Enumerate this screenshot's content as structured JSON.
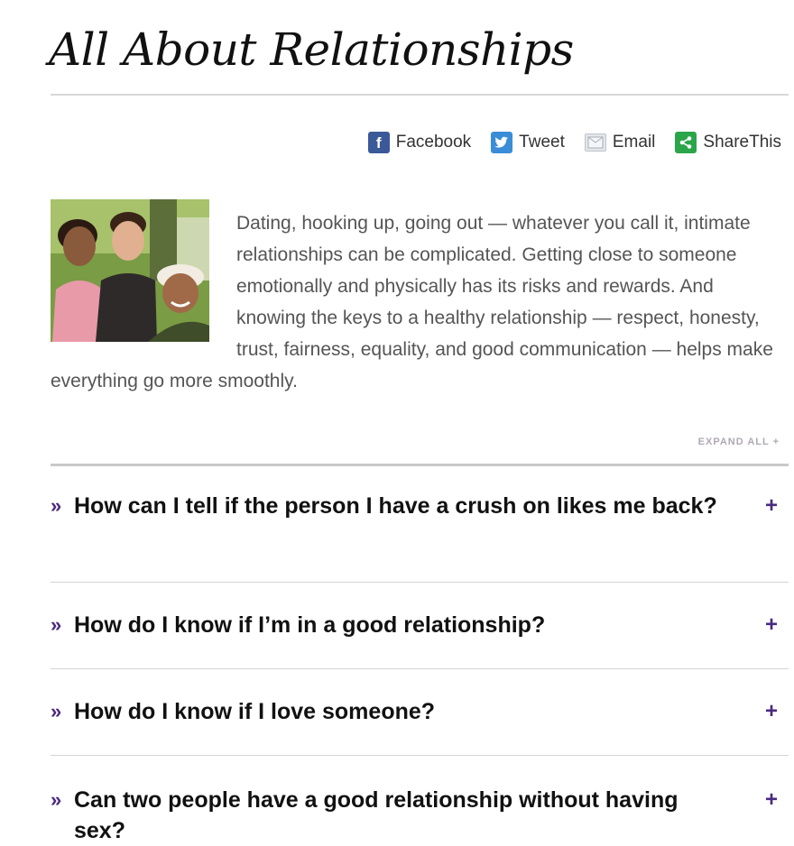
{
  "page": {
    "title": "All About Relationships"
  },
  "share": [
    {
      "label": "Facebook",
      "icon": "facebook-icon",
      "glyph": "f"
    },
    {
      "label": "Tweet",
      "icon": "twitter-icon",
      "glyph": ""
    },
    {
      "label": "Email",
      "icon": "email-icon",
      "glyph": ""
    },
    {
      "label": "ShareThis",
      "icon": "sharethis-icon",
      "glyph": "<"
    }
  ],
  "intro": {
    "text": "Dating, hooking up, going out — whatever you call it, intimate relationships can be complicated. Getting close to someone emotionally and physically has its risks and rewards. And knowing the keys to a healthy relationship — respect, honesty, trust, fairness, equality, and good communication — helps make everything go more smoothly."
  },
  "expand": {
    "label": "EXPAND ALL +"
  },
  "faq": {
    "chevron": "»",
    "plus": "+",
    "items": [
      {
        "question": "How can I tell if the person I have a crush on likes me back?"
      },
      {
        "question": "How do I know if I’m in a good relationship?"
      },
      {
        "question": "How do I know if I love someone?"
      },
      {
        "question": "Can two people have a good relationship without having sex?"
      }
    ]
  },
  "colors": {
    "accent": "#4a2a82",
    "facebook": "#3b5998",
    "twitter": "#3a8dd6",
    "sharethis": "#2aa54a"
  }
}
